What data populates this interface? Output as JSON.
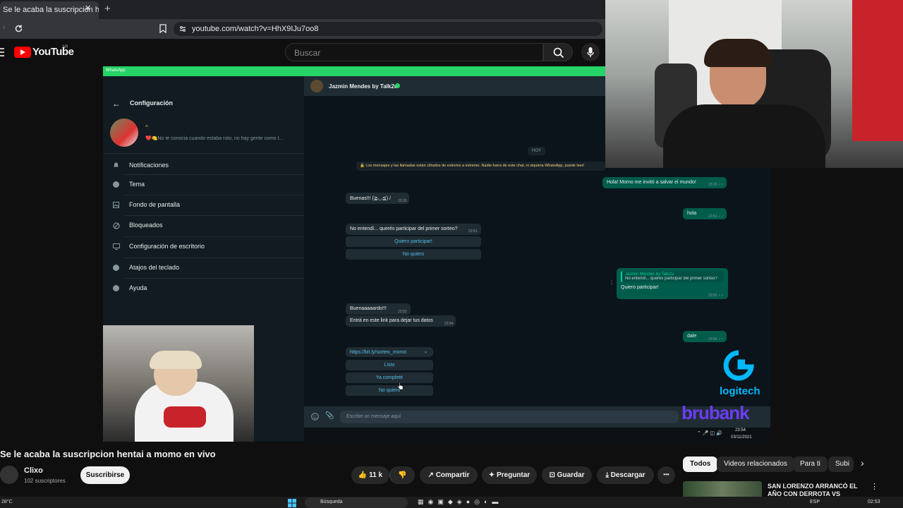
{
  "browser": {
    "tab_title": "Se le acaba la suscripcion hen...",
    "tab_close": "✕",
    "new_tab": "+",
    "url": "youtube.com/watch?v=HhX9IJu7oo8"
  },
  "youtube": {
    "logo_text": "YouTube",
    "country": "AR",
    "search_placeholder": "Buscar"
  },
  "whatsapp": {
    "app_bar": "WhatsApp",
    "settings_title": "Configuración",
    "profile_status": "❤️🍋No te conocia cuando estaba roto, no hay gente como t...",
    "menu": [
      "Notificaciones",
      "Tema",
      "Fondo de pantalla",
      "Bloqueados",
      "Configuración de escritorio",
      "Atajos del teclado",
      "Ayuda"
    ],
    "contact_name": "Jazmin Mendes by Talk2u",
    "date_badge": "HOY",
    "encryption_notice": "🔒 Los mensajes y las llamadas están cifrados de extremo a extremo. Nadie fuera de este chat, ni siquiera WhatsApp, puede leerl",
    "messages": {
      "out1": {
        "text": "Hola! Momo me invitó a salvar el mundo!",
        "time": "23:29 ✓✓"
      },
      "in1": {
        "text": "Buenas!!! (≧◡≦) /",
        "time": "23:30"
      },
      "out2": {
        "text": "hola",
        "time": "23:51 ✓✓"
      },
      "in2": {
        "text": "No entendí... querés participar del primer sorteo?",
        "time": "23:51"
      },
      "in2_btn1": "Quiero participar!",
      "in2_btn2": "No quiero",
      "reply_quote_name": "Jazmin Mendes by Talk2u",
      "reply_quote_text": "No entendí... querés participar del primer sorteo?",
      "out3": {
        "text": "Quiero participar!",
        "time": "23:52 ✓✓"
      },
      "in3": {
        "text": "Buenaaaaardo!!!",
        "time": "23:53"
      },
      "in4": {
        "text": "Entrá en este link para dejar tus datos",
        "time": "23:54"
      },
      "out4": {
        "text": "dale",
        "time": "23:54 ✓✓"
      },
      "link": "https://bit.ly/sorteo_momo",
      "btn_listo": "Listo",
      "btn_ya": "Ya completé",
      "btn_no": "No quiero"
    },
    "input_placeholder": "Escribe un mensaje aquí",
    "clock_time": "23:54",
    "clock_date": "03/11/2021"
  },
  "sponsors": {
    "logitech": "logitech",
    "brubank": "brubank"
  },
  "video": {
    "title": "Se le acaba la suscripcion hentai a momo en vivo",
    "channel": "Clixo",
    "subscribers": "102 suscriptores",
    "subscribe": "Suscribirse",
    "likes": "11 k",
    "share": "Compartir",
    "ask": "Preguntar",
    "save": "Guardar",
    "download": "Descargar",
    "more": "•••"
  },
  "chips": [
    "Todos",
    "Videos relacionados",
    "Para ti",
    "Subi"
  ],
  "related": {
    "title": "SAN LORENZO ARRANCÓ EL AÑO CON DERROTA VS"
  },
  "taskbar": {
    "weather": "28°C",
    "search": "Búsqueda",
    "lang": "ESP",
    "time": "02:53"
  },
  "colors": {
    "wa_green": "#25d366",
    "yt_red": "#ff0000",
    "logitech_blue": "#00b8fc",
    "brubank_purple": "#6b3df5"
  }
}
